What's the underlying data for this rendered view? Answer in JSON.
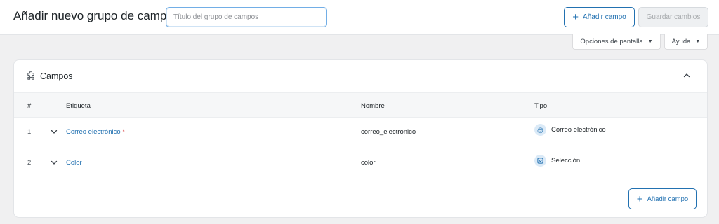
{
  "header": {
    "title": "Añadir nuevo grupo de campos",
    "title_placeholder": "Título del grupo de campos",
    "add_field_label": "Añadir campo",
    "save_label": "Guardar cambios"
  },
  "screen_tabs": {
    "screen_options_label": "Opciones de pantalla",
    "help_label": "Ayuda"
  },
  "panel": {
    "title": "Campos",
    "columns": {
      "num": "#",
      "label": "Etiqueta",
      "name": "Nombre",
      "type": "Tipo"
    },
    "rows": [
      {
        "num": "1",
        "label": "Correo electrónico",
        "required": "*",
        "name": "correo_electronico",
        "type": "Correo electrónico",
        "type_icon": "at-icon"
      },
      {
        "num": "2",
        "label": "Color",
        "required": "",
        "name": "color",
        "type": "Selección",
        "type_icon": "select-icon"
      }
    ],
    "add_field_label": "Añadir campo"
  },
  "colors": {
    "accent": "#2271b1",
    "required": "#d63638",
    "background": "#f0f0f1"
  }
}
